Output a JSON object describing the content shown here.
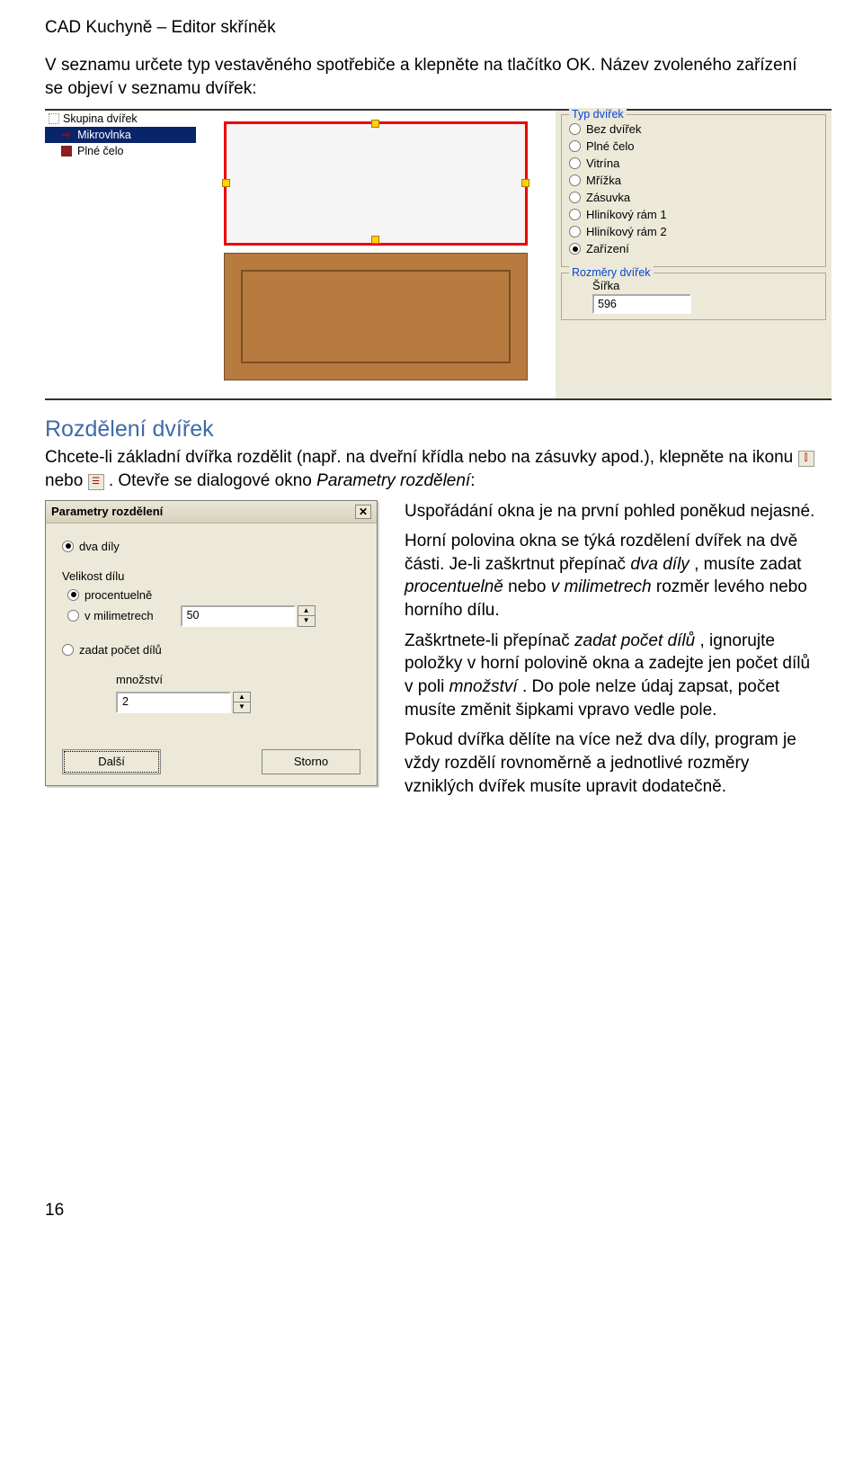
{
  "header": "CAD Kuchyně – Editor skříněk",
  "intro": "V seznamu určete typ vestavěného spotřebiče a klepněte na tlačítko OK. Název zvoleného zařízení se objeví v seznamu dvířek:",
  "tree": {
    "root_label": "Skupina dvířek",
    "items": [
      {
        "label": "Mikrovlnka",
        "selected": true
      },
      {
        "label": "Plné čelo",
        "selected": false
      }
    ]
  },
  "door_type": {
    "legend": "Typ dvířek",
    "options": [
      "Bez dvířek",
      "Plné čelo",
      "Vitrína",
      "Mřížka",
      "Zásuvka",
      "Hliníkový rám 1",
      "Hliníkový rám 2",
      "Zařízení"
    ],
    "selected": "Zařízení"
  },
  "door_dim": {
    "legend": "Rozměry dvířek",
    "width_label": "Šířka",
    "width_value": "596"
  },
  "section_heading": "Rozdělení dvířek",
  "para1_a": "Chcete-li základní dvířka rozdělit (např. na dveřní křídla nebo na zásuvky apod.), klepněte na ikonu ",
  "para1_b": " nebo ",
  "para1_c": ". Otevře se dialogové okno ",
  "para1_ital": "Parametry rozdělení",
  "para1_d": ":",
  "dialog": {
    "title": "Parametry rozdělení",
    "dva_dily": "dva díly",
    "velikost_label": "Velikost dílu",
    "velikost_options": [
      "procentuelně",
      "v milimetrech"
    ],
    "velikost_selected": "procentuelně",
    "velikost_value": "50",
    "zadat_pocet": "zadat počet dílů",
    "mnozstvi_label": "množství",
    "mnozstvi_value": "2",
    "btn_next": "Další",
    "btn_cancel": "Storno"
  },
  "sidetext": {
    "p1": "Uspořádání okna je na první pohled poněkud nejasné.",
    "p2a": "Horní polovina okna se týká rozdělení dvířek na dvě části. Je-li zaškrtnut přepínač ",
    "p2i1": "dva díly",
    "p2b": ", musíte zadat ",
    "p2i2": "procentuelně",
    "p2c": " nebo ",
    "p2i3": "v milimetrech",
    "p2d": " rozměr levého nebo horního dílu.",
    "p3a": "Zaškrtnete-li přepínač ",
    "p3i1": "zadat počet dílů",
    "p3b": ", ignorujte položky v horní polovině okna a zadejte jen počet dílů v poli ",
    "p3i2": "množství",
    "p3c": ". Do pole nelze údaj zapsat, počet musíte změnit šipkami vpravo vedle pole.",
    "p4": "Pokud dvířka dělíte na více než dva díly, program je vždy rozdělí rovnoměrně a jednotlivé rozměry vzniklých dvířek musíte upravit dodatečně."
  },
  "pagenum": "16"
}
